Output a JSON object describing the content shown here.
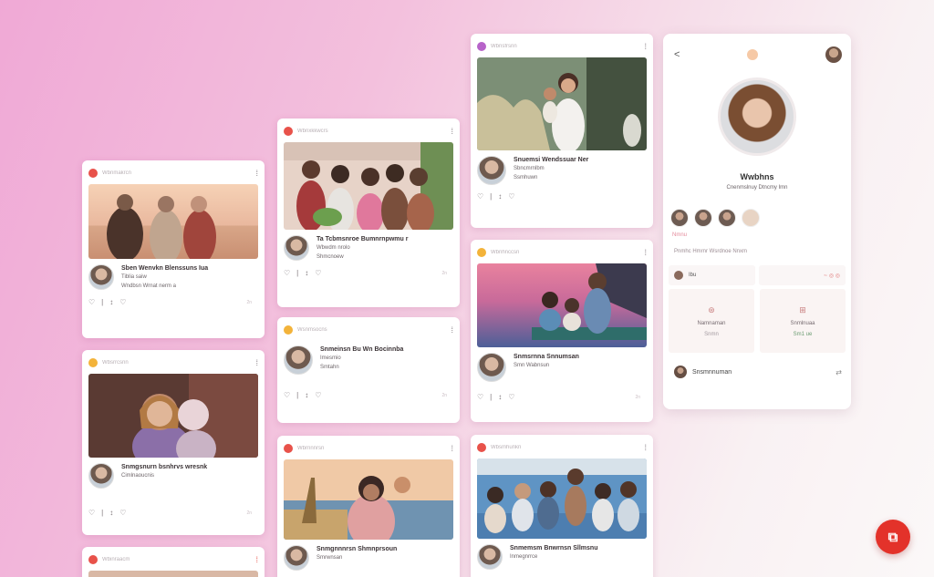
{
  "cards": [
    {
      "source": "Wbnmakrcn",
      "title": "Sben Wenvkn Blenssuns Iua",
      "sub": "Tiblia saiw",
      "sub2": "Wndbsn Wrnat nerm a",
      "actions": [
        "♡",
        "|",
        "↕",
        "♡"
      ],
      "time": "2n"
    },
    {
      "source": "Wbsrrcsnn",
      "title": "Snmgsnurn bsnhrvs wresnk",
      "sub": "Cimlnaoucnis",
      "sub2": "",
      "actions": [
        "♡",
        "|",
        "↕",
        "♡"
      ],
      "time": "2n"
    },
    {
      "source": "Wbinraacm",
      "title": "",
      "sub": "",
      "sub2": "",
      "actions": [],
      "time": ""
    },
    {
      "source": "Wbnxkkwcrs",
      "title": "Ta Tcbmsnroe Bumnrnpwmu r",
      "sub": "Wbwdm nrolo",
      "sub2": "Shmcnoew",
      "actions": [
        "♡",
        "|",
        "↕",
        "♡"
      ],
      "time": "2n"
    },
    {
      "source": "Wsnmsocns",
      "title": "Snmeinsn Bu Wn Bocinnba",
      "sub": "Imesmio",
      "sub2": "Smtahn",
      "actions": [
        "♡",
        "|",
        "↕",
        "♡"
      ],
      "time": "2n"
    },
    {
      "source": "Wbrnnnrsn",
      "title": "Snmgnnnrsn Shmnprsoun",
      "sub": "Smrwnsan",
      "sub2": "",
      "actions": [],
      "time": ""
    },
    {
      "source": "Wbnsfrsnn",
      "title": "Snuemsi Wendssuar Ner",
      "sub": "Sbncmrnlbm",
      "sub2": "Ssmhuwn",
      "actions": [
        "♡",
        "|",
        "↕",
        "♡"
      ],
      "time": ""
    },
    {
      "source": "Wbnhnccsn",
      "title": "Snmsrnna Snnumsan",
      "sub": "Smn Wabnsun",
      "sub2": "",
      "actions": [
        "♡",
        "|",
        "↕",
        "♡"
      ],
      "time": "2n"
    },
    {
      "source": "Wbsmhunkn",
      "title": "Snmemsm Bnwrnsn Sllmsnu",
      "sub": "Inmegnrrce",
      "sub2": "",
      "actions": [],
      "time": ""
    }
  ],
  "profile": {
    "back": "<",
    "name": "Wwbhns",
    "tagline": "Cnenmslnuy Dtncmy Imn",
    "note": "Nmnu",
    "links": "Pnmhc Hmrnr Wsrdnoe Nnxm",
    "row_left": "Ibu",
    "row_right": "ꞏ◦ ◎ ◎",
    "tile1_icon": "⊛",
    "tile1_label": "Namnaman",
    "tile1_sub": "Snmn",
    "tile2_icon": "⊞",
    "tile2_label": "Snmlnuaa",
    "tile2_sub": "Sm1 ue",
    "bottom": "Snsmnnuman",
    "bottom_icon": "⇄"
  },
  "fab_icon": "⧉"
}
